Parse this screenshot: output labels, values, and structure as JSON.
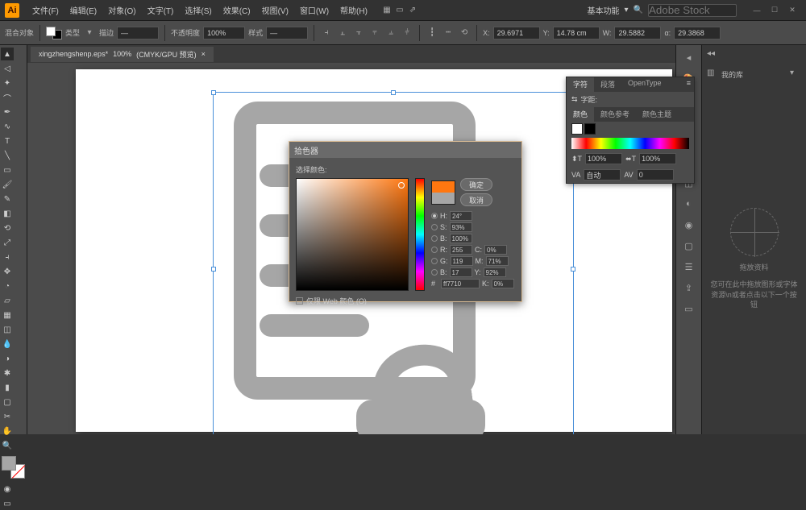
{
  "app": {
    "name": "Ai"
  },
  "menu": [
    "文件(F)",
    "编辑(E)",
    "对象(O)",
    "文字(T)",
    "选择(S)",
    "效果(C)",
    "视图(V)",
    "窗口(W)",
    "帮助(H)"
  ],
  "workspace_label": "基本功能",
  "search_placeholder": "Adobe Stock",
  "controlbar": {
    "label": "混合对象",
    "kind": "类型",
    "stroke_label": "描边",
    "stroke_value": "—",
    "opacity_label": "不透明度",
    "opacity_value": "100%",
    "style_label": "样式",
    "xywh": {
      "x_label": "X:",
      "x": "29.6971",
      "y_label": "Y:",
      "y": "14.78 cm",
      "w_label": "W:",
      "w": "29.5882",
      "a_label": "α:",
      "a": "29.3868"
    }
  },
  "doc_tab": {
    "name": "xingzhengshenp.eps*",
    "zoom": "100%",
    "mode": "(CMYK/GPU 预览)"
  },
  "char_panel": {
    "tabs": [
      "字符",
      "段落",
      "OpenType"
    ],
    "sub_tabs": [
      "颜色",
      "颜色参考",
      "颜色主题"
    ],
    "font_label": "字距:",
    "size": "100%",
    "leading": "100%",
    "tracking": "自动",
    "kerning": "0"
  },
  "color_dialog": {
    "title": "拾色器",
    "label": "选择颜色:",
    "ok": "确定",
    "cancel": "取消",
    "new_color": "#ff7710",
    "old_color": "#a6a6a6",
    "fields": {
      "H": "24°",
      "S": "93%",
      "B": "100%",
      "R": "255",
      "G": "119",
      "Bv": "17",
      "C": "0%",
      "M": "71%",
      "Y": "92%",
      "K": "0%"
    },
    "hex_label": "#",
    "hex": "ff7710",
    "web_only": "仅限 Web 颜色 (O)"
  },
  "right_side": {
    "search_label": "我的库",
    "placeholder_title": "拖放资料",
    "placeholder_text": "您可在此中拖放图形或字体资源\\n或者点击以下一个按钮"
  },
  "colors": {
    "accent": "#ff9a00",
    "selection": "#4a90d9",
    "shape": "#a6a6a6"
  }
}
